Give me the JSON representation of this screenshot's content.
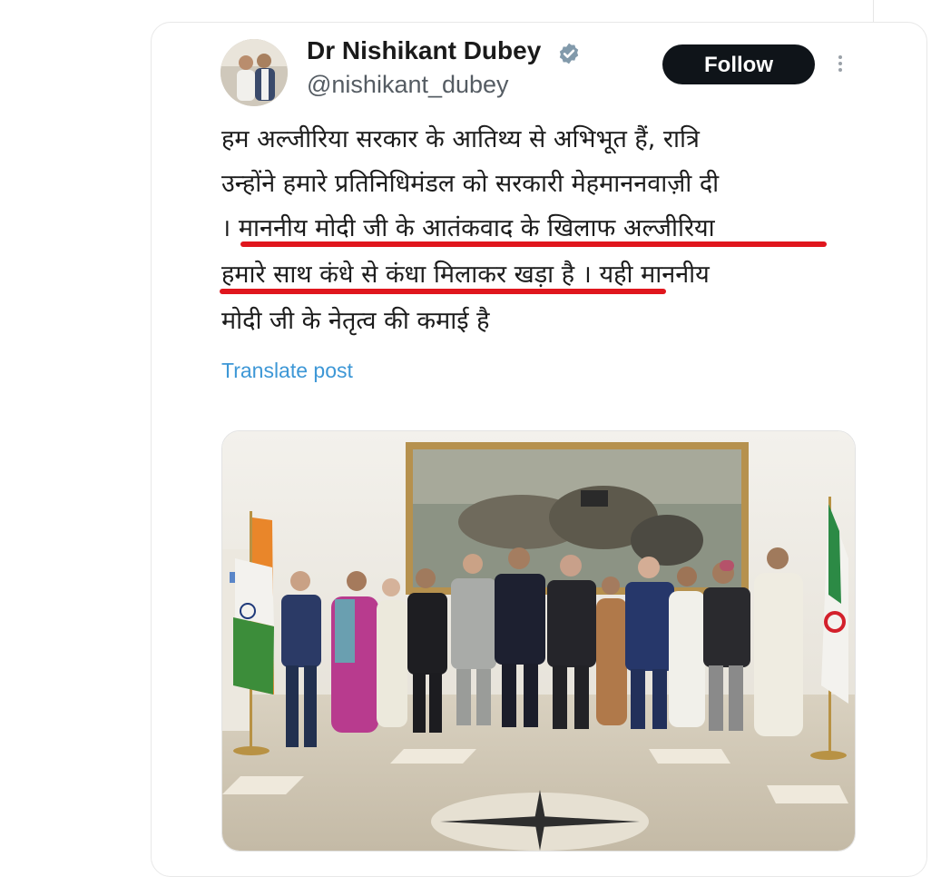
{
  "author": {
    "name": "Dr Nishikant Dubey",
    "handle": "@nishikant_dubey",
    "verified_icon": "verified-badge-icon",
    "avatar_icon": "avatar-photo"
  },
  "actions": {
    "follow_label": "Follow",
    "more_icon": "more-options-icon"
  },
  "post": {
    "lines": [
      "हम अल्जीरिया सरकार के आतिथ्य से अभिभूत हैं, रात्रि",
      "उन्होंने हमारे प्रतिनिधिमंडल को सरकारी मेहमाननवाज़ी दी",
      "। माननीय मोदी जी के आतंकवाद के खिलाफ अल्जीरिया",
      "हमारे साथ कंधे से कंधा मिलाकर खड़ा है । यही माननीय",
      "मोदी जी के नेतृत्व की कमाई है"
    ],
    "translate_label": "Translate post"
  },
  "media": {
    "description_icon": "group-photo-image"
  },
  "colors": {
    "follow_bg": "#0f1419",
    "link": "#3d97d6",
    "underline": "#e0161d",
    "verified": "#829aab"
  }
}
